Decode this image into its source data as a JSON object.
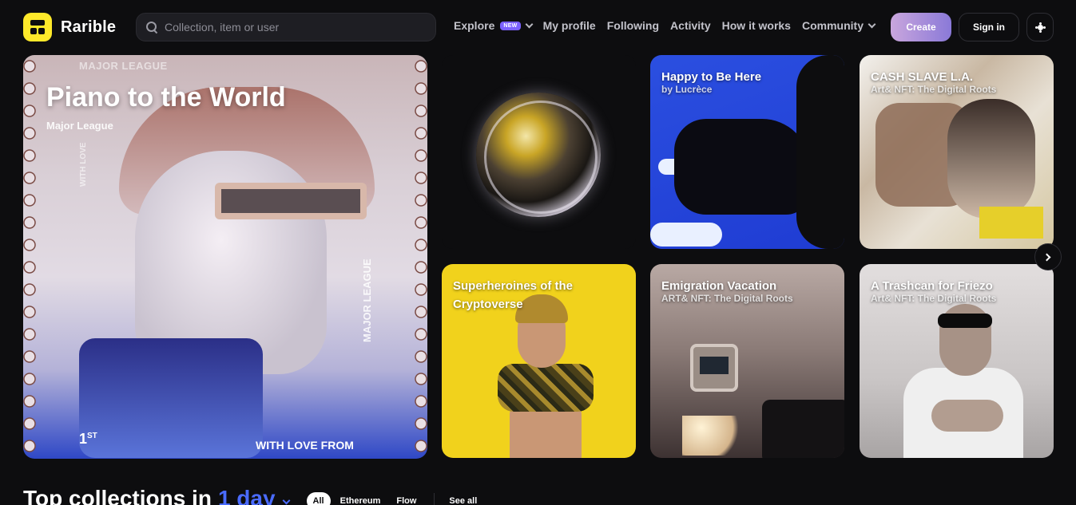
{
  "header": {
    "logo_text": "Rarible",
    "search_placeholder": "Collection, item or user",
    "nav": [
      {
        "label": "Explore",
        "badge": "NEW"
      },
      {
        "label": "My profile"
      },
      {
        "label": "Following"
      },
      {
        "label": "Activity"
      },
      {
        "label": "How it works"
      },
      {
        "label": "Community"
      }
    ],
    "create_label": "Create",
    "signin_label": "Sign in",
    "theme_icon": "sun-icon"
  },
  "hero": {
    "title": "Piano to the World",
    "subtitle": "Major League",
    "mark_top": "MAJOR LEAGUE",
    "mark_bottom": "WITH LOVE FROM",
    "mark_side": "MAJOR LEAGUE",
    "mark_side_left": "WITH LOVE",
    "mark_rank": "1",
    "mark_rank_suffix": "ST"
  },
  "cards": {
    "happy": {
      "title": "Happy to Be Here",
      "subtitle": "by Lucrèce"
    },
    "cash": {
      "title": "CASH SLAVE L.A.",
      "subtitle": "Art& NFT: The Digital Roots"
    },
    "super": {
      "title": "Superheroines of the Cryptoverse"
    },
    "emig": {
      "title": "Emigration Vacation",
      "subtitle": "ART& NFT: The Digital Roots"
    },
    "trash": {
      "title": "A Trashcan for Friezo",
      "subtitle": "Art& NFT: The Digital Roots"
    }
  },
  "top_collections": {
    "title": "Top collections in",
    "period": "1 day",
    "filters": [
      "All",
      "Ethereum",
      "Flow"
    ],
    "active_filter": "All",
    "see_all": "See all"
  },
  "colors": {
    "background": "#0d0d0f",
    "accent_blue": "#4a6bff",
    "logo_yellow": "#fee92a",
    "badge_purple": "#7b61ff"
  }
}
